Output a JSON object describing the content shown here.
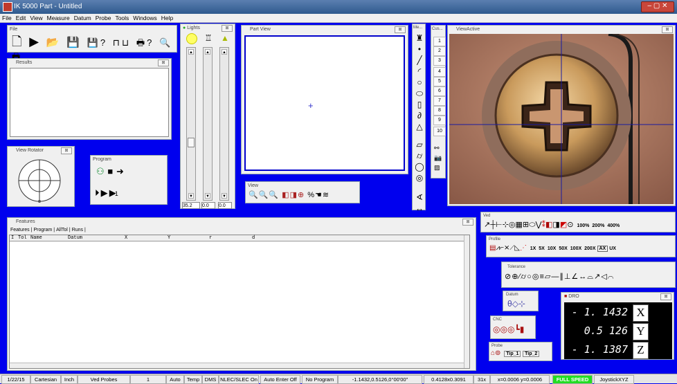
{
  "window": {
    "title": "IK 5000 Part - Untitled"
  },
  "menu": [
    "File",
    "Edit",
    "View",
    "Measure",
    "Datum",
    "Probe",
    "Tools",
    "Windows",
    "Help"
  ],
  "file_panel": {
    "title": "File"
  },
  "results_panel": {
    "title": "Results"
  },
  "view_rotator": {
    "title": "View Rotator"
  },
  "program_panel": {
    "title": "Program"
  },
  "lights_panel": {
    "title": "Lights",
    "values": [
      "35.2",
      "0.0",
      "0.0"
    ],
    "levels": [
      0.55,
      0.0,
      0.0
    ]
  },
  "part_view": {
    "title": "Part View"
  },
  "view_toolbar": {
    "title": "View"
  },
  "measure_panel": {
    "title": "Me..."
  },
  "custom_panel": {
    "title": "Cus...",
    "buttons": [
      "1",
      "2",
      "3",
      "4",
      "5",
      "6",
      "7",
      "8",
      "9",
      "10"
    ]
  },
  "view_active": {
    "title": "ViewActive"
  },
  "features_panel": {
    "title": "Features",
    "tabs": [
      "Features",
      "Program",
      "AllTol",
      "Runs"
    ],
    "columns": [
      "I",
      "Tol",
      "Name",
      "Datum",
      "X",
      "Y",
      "r",
      "d"
    ]
  },
  "ved_panel": {
    "title": "Ved",
    "zooms": [
      "100%",
      "200%",
      "400%"
    ]
  },
  "profile_panel": {
    "title": "Profile",
    "zooms": [
      "1X",
      "5X",
      "10X",
      "50X",
      "100X",
      "200X",
      "AX",
      "UX"
    ]
  },
  "tolerance_panel": {
    "title": "Tolerance"
  },
  "datum_panel": {
    "title": "Datum"
  },
  "cnc_panel": {
    "title": "CNC"
  },
  "probe_panel": {
    "title": "Probe",
    "tips": [
      "Tip_1",
      "Tip_2"
    ]
  },
  "dro_panel": {
    "title": "DRO",
    "rows": [
      {
        "value": "- 1. 1432",
        "axis": "X"
      },
      {
        "value": "0.5 126",
        "axis": "Y"
      },
      {
        "value": "- 1. 1387",
        "axis": "Z"
      }
    ]
  },
  "statusbar": {
    "date": "1/22/15",
    "coord": "Cartesian",
    "units": "Inch",
    "probes": "Ved Probes",
    "num": "1",
    "auto": "Auto",
    "temp": "Temp",
    "dms": "DMS",
    "nlec": "NLEC/SLEC On",
    "autoenter": "Auto Enter Off",
    "program": "No Program",
    "position": "-1.1432,0.5126,0°00'00\"",
    "fov": "0.4128x0.3091",
    "mag": "31x",
    "cursor": "x=0.0006 y=0.0006",
    "speed": "FULL SPEED",
    "joystick": "JoystickXYZ"
  },
  "colors": {
    "background": "#0000ee",
    "speed": "#22dd22",
    "title_grad": "#2f5a8e"
  }
}
